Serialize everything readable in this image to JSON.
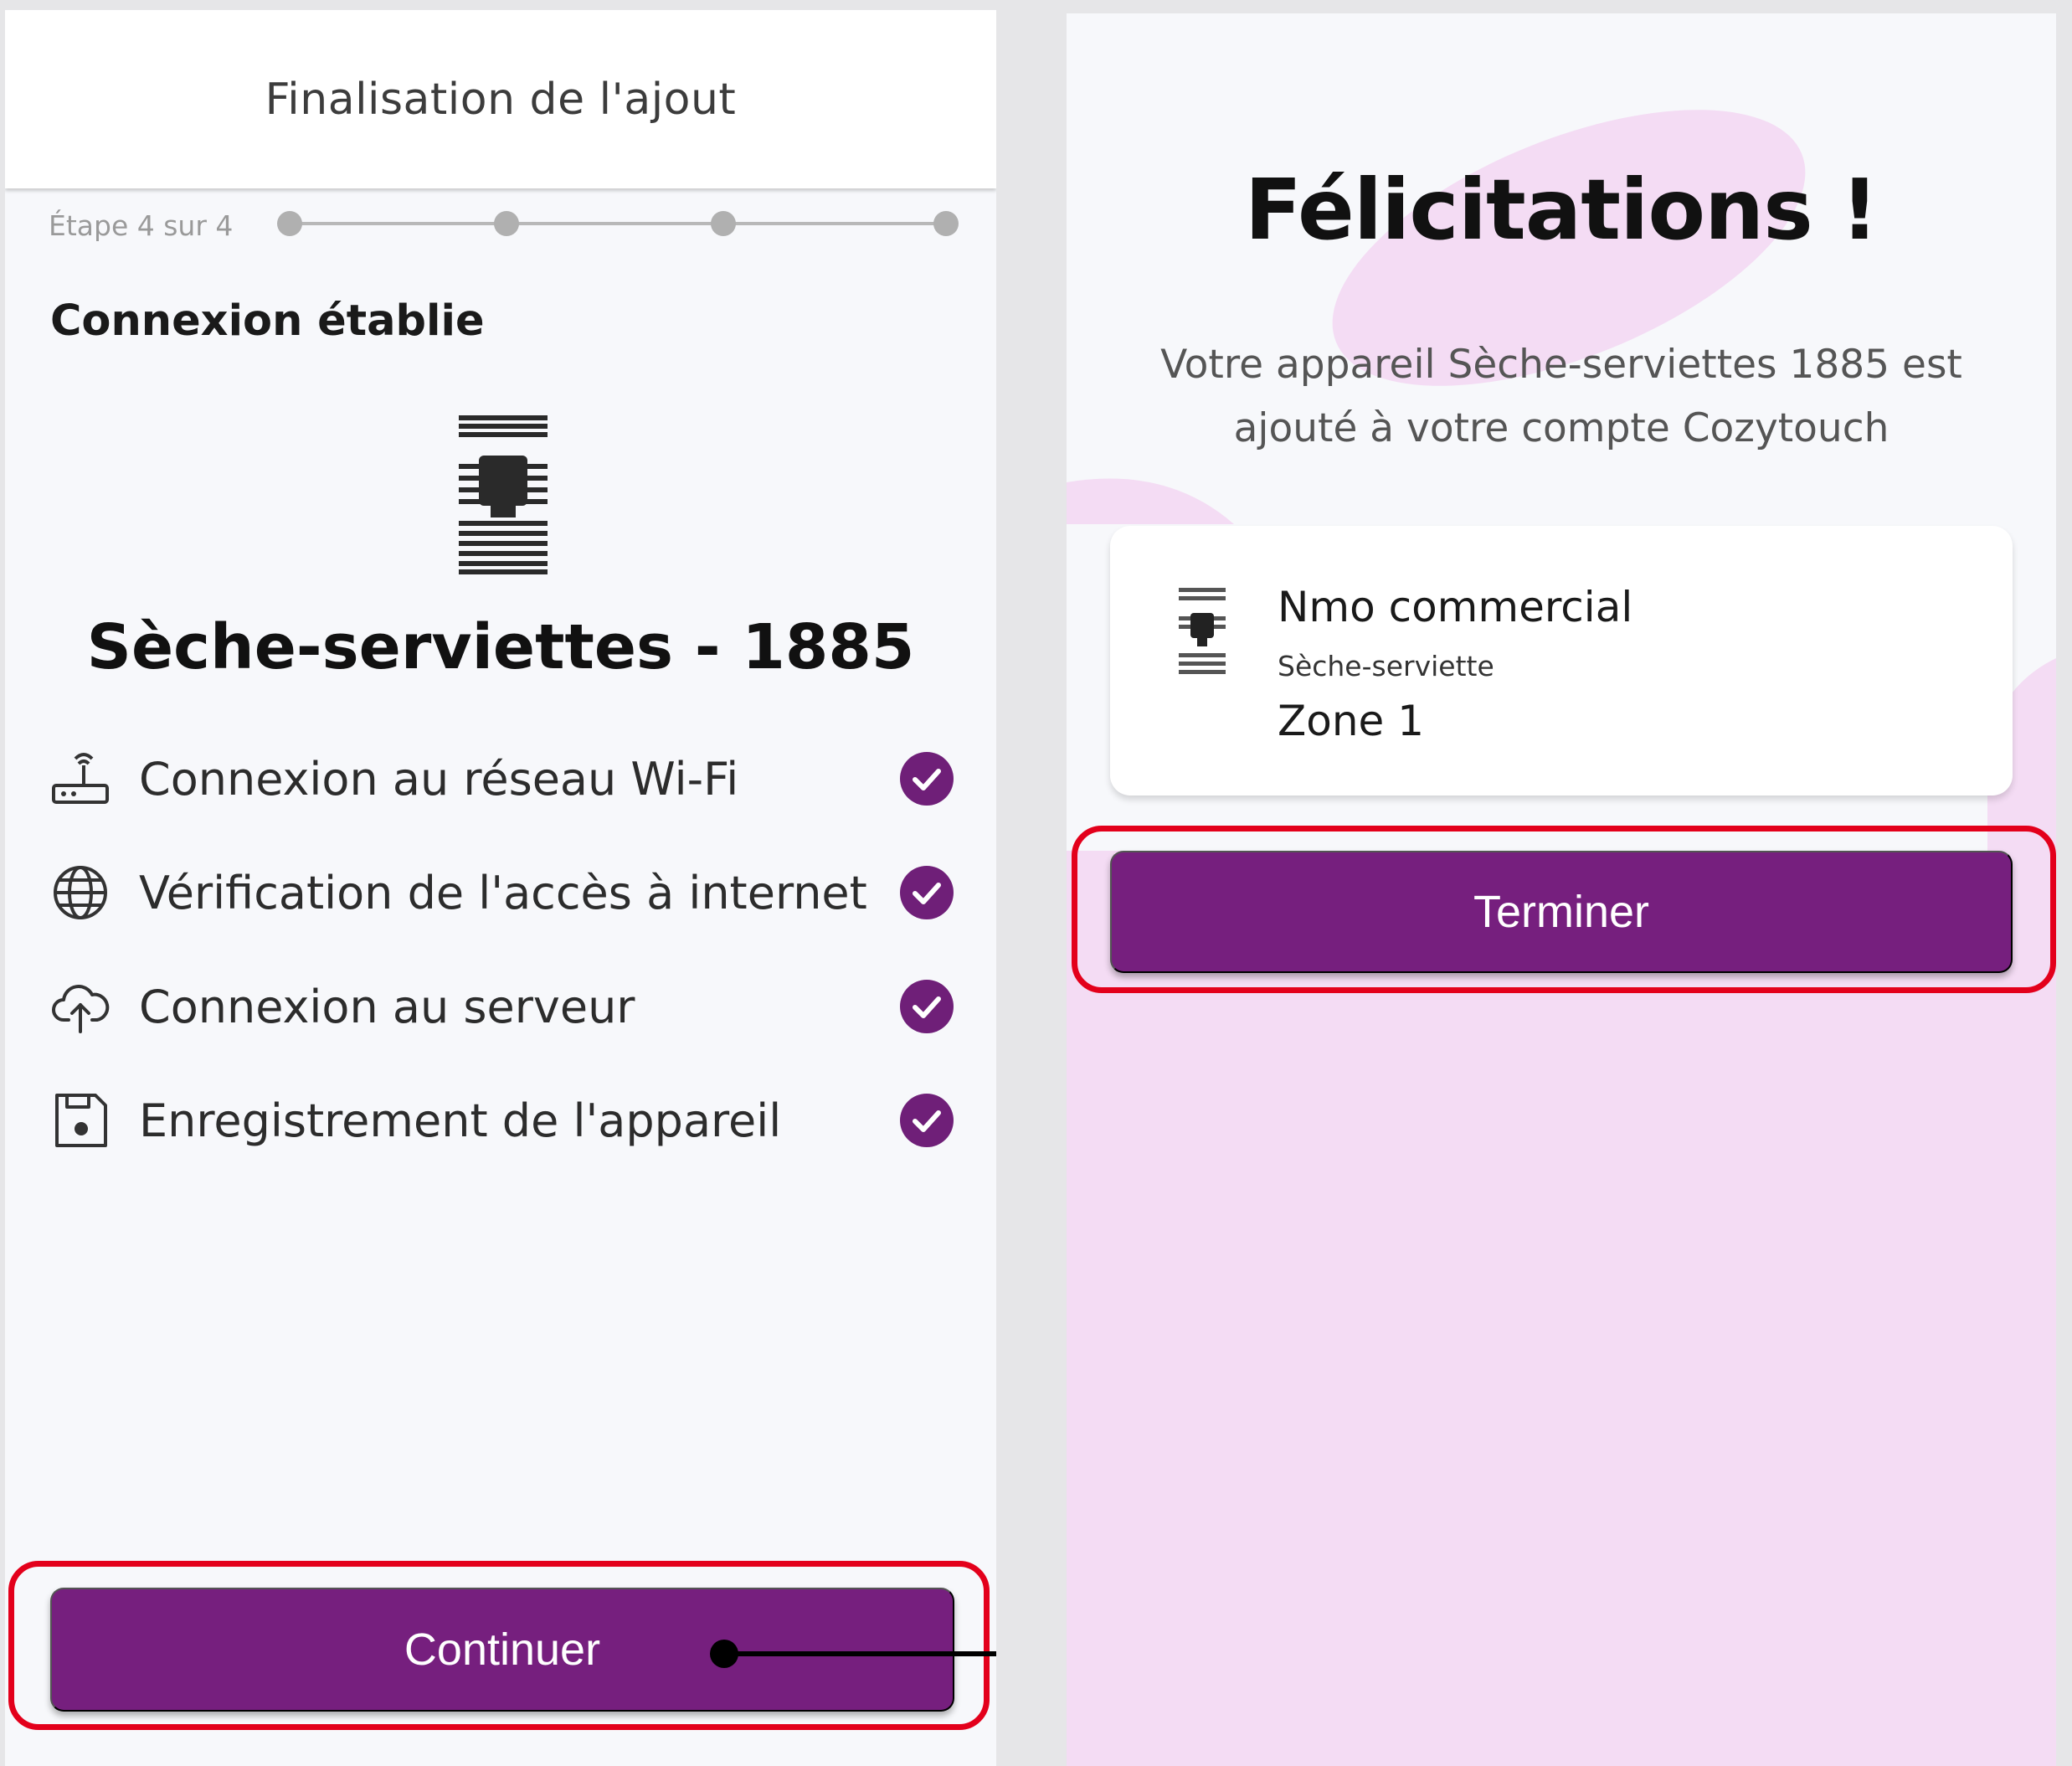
{
  "left_screen": {
    "header": {
      "title": "Finalisation de l'ajout"
    },
    "stepper": {
      "label": "Étape 4 sur 4",
      "current": 4,
      "total": 4
    },
    "section_title": "Connexion établie",
    "device": {
      "icon": "towel-radiator-icon",
      "name": "Sèche-serviettes - 1885"
    },
    "checklist": [
      {
        "icon": "router-icon",
        "label": "Connexion au réseau Wi-Fi",
        "status": "check-circle-icon"
      },
      {
        "icon": "globe-icon",
        "label": "Vérification de l'accès à internet",
        "status": "check-circle-icon"
      },
      {
        "icon": "cloud-upload-icon",
        "label": "Connexion au serveur",
        "status": "check-circle-icon"
      },
      {
        "icon": "save-icon",
        "label": "Enregistrement de l'appareil",
        "status": "check-circle-icon"
      }
    ],
    "continue_label": "Continuer"
  },
  "right_screen": {
    "title": "Félicitations !",
    "subtitle": "Votre appareil Sèche-serviettes 1885 est ajouté à votre compte Cozytouch",
    "device_card": {
      "icon": "towel-radiator-icon",
      "name": "Nmo commercial",
      "type": "Sèche-serviette",
      "zone": "Zone 1"
    },
    "finish_label": "Terminer"
  },
  "colors": {
    "primary": "#761f7e",
    "check": "#6f1f78",
    "background_pink": "#f4dcf4",
    "highlight_red": "#e3001b"
  }
}
